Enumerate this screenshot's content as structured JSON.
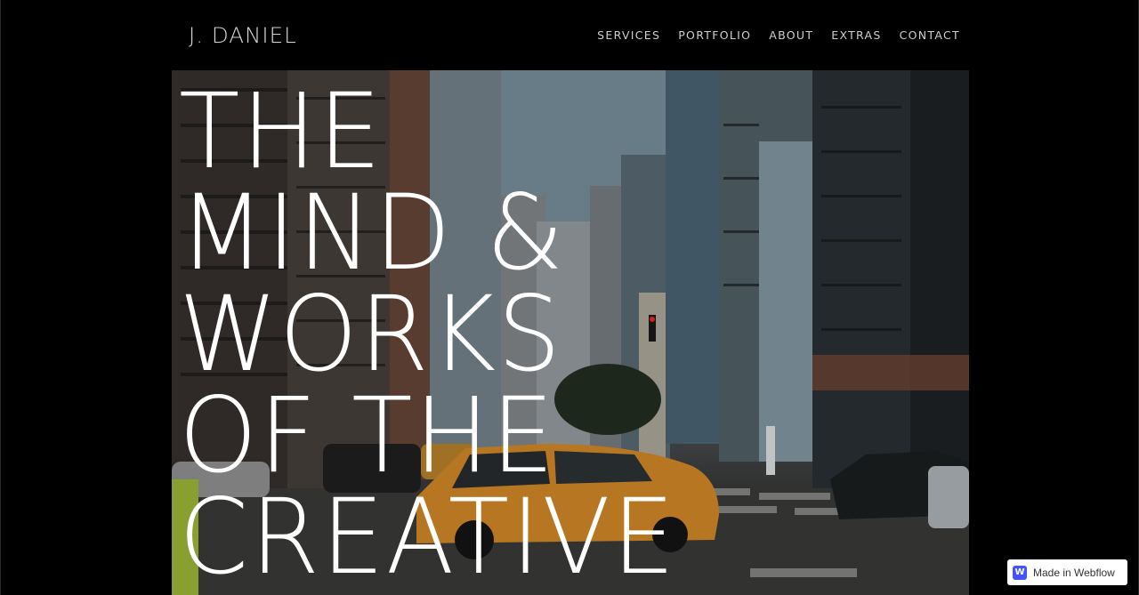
{
  "header": {
    "brand": "J. DANIEL",
    "nav": [
      {
        "label": "SERVICES"
      },
      {
        "label": "PORTFOLIO"
      },
      {
        "label": "ABOUT"
      },
      {
        "label": "EXTRAS"
      },
      {
        "label": "CONTACT"
      }
    ]
  },
  "hero": {
    "headline_lines": [
      "THE",
      "MIND &",
      "WORKS",
      "OF THE",
      "CREATIVE"
    ],
    "image_description": "city-street-taxi-photo"
  },
  "badge": {
    "label": "Made in Webflow",
    "icon": "webflow-logo-icon"
  },
  "colors": {
    "background": "#000000",
    "nav_text": "#cfcfcf",
    "brand_text": "#d6d6d6",
    "taxi_orange": "#e0902a",
    "webflow_blue": "#4353ff"
  }
}
